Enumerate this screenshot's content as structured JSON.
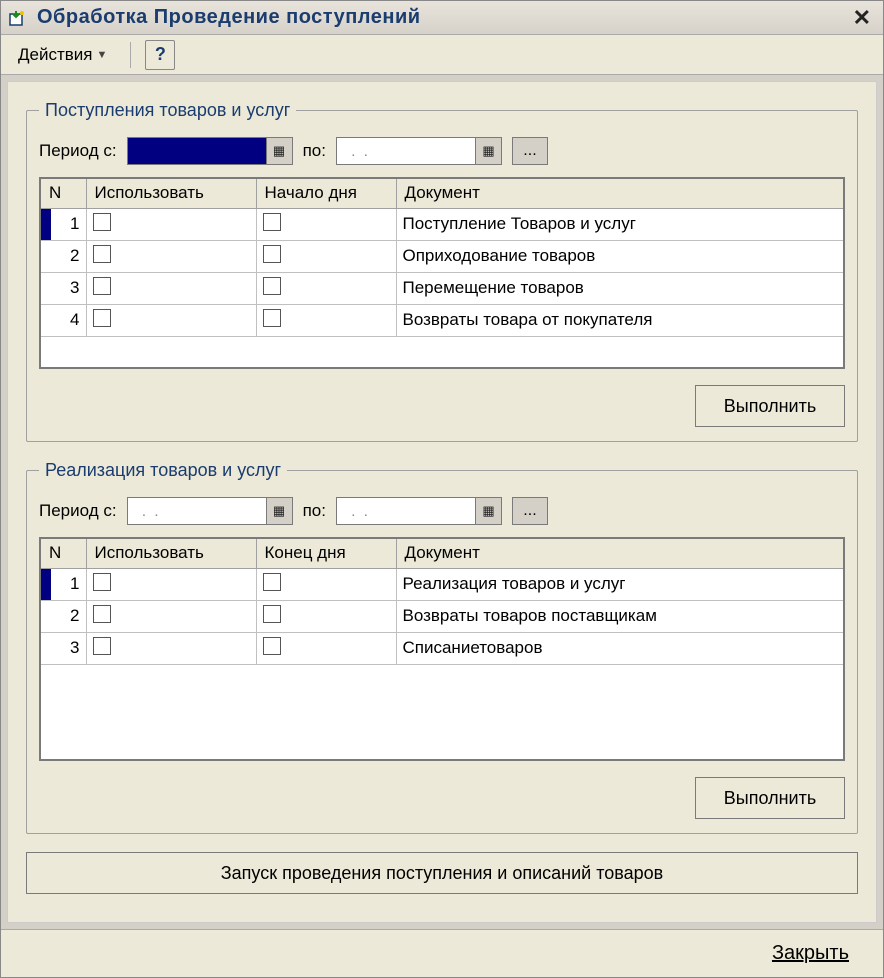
{
  "window": {
    "title": "Обработка  Проведение поступлений"
  },
  "toolbar": {
    "actions_label": "Действия",
    "help_label": "?"
  },
  "section1": {
    "legend": "Поступления товаров и услуг",
    "period_from_label": "Период с:",
    "period_to_label": "по:",
    "date_from_value": "",
    "date_to_value": "  .  .",
    "columns": {
      "n": "N",
      "use": "Использовать",
      "daystart": "Начало дня",
      "doc": "Документ"
    },
    "rows": [
      {
        "n": "1",
        "doc": "Поступление Товаров и услуг"
      },
      {
        "n": "2",
        "doc": "Оприходование товаров"
      },
      {
        "n": "3",
        "doc": "Перемещение товаров"
      },
      {
        "n": "4",
        "doc": "Возвраты товара от покупателя"
      }
    ],
    "execute_label": "Выполнить"
  },
  "section2": {
    "legend": "Реализация товаров и услуг",
    "period_from_label": "Период с:",
    "period_to_label": "по:",
    "date_from_value": "  .  .",
    "date_to_value": "  .  .",
    "columns": {
      "n": "N",
      "use": "Использовать",
      "dayend": "Конец дня",
      "doc": "Документ"
    },
    "rows": [
      {
        "n": "1",
        "doc": "Реализация товаров и услуг"
      },
      {
        "n": "2",
        "doc": "Возвраты товаров поставщикам"
      },
      {
        "n": "3",
        "doc": "Списаниетоваров"
      }
    ],
    "execute_label": "Выполнить"
  },
  "run_all_label": "Запуск проведения поступления и описаний товаров",
  "close_label": "Закрыть"
}
